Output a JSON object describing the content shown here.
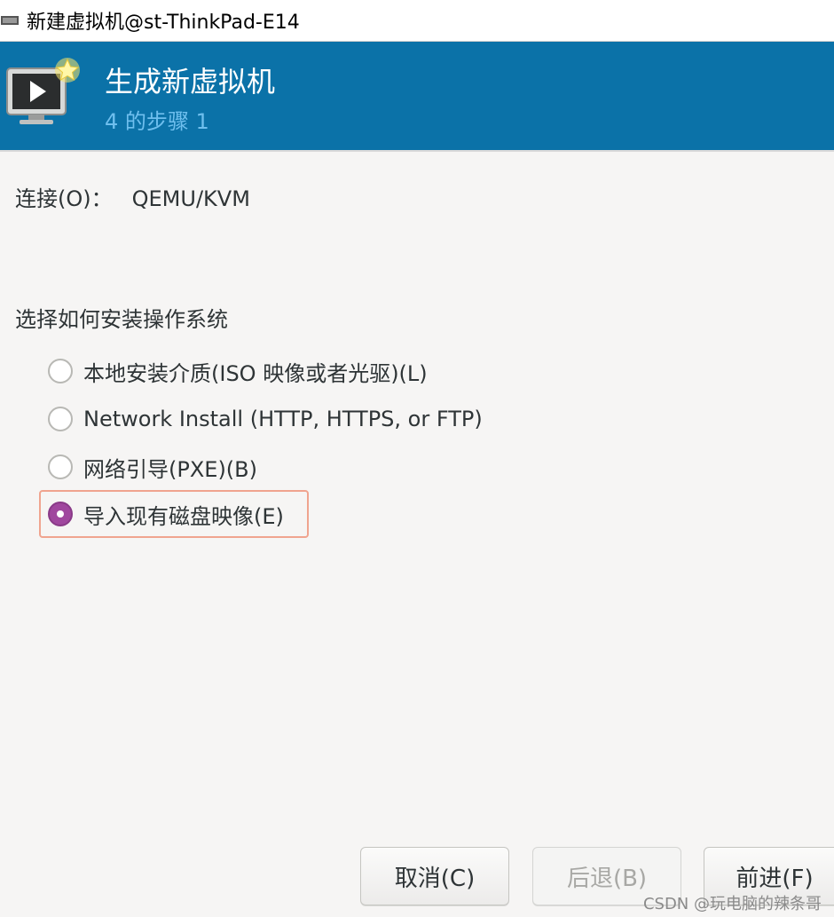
{
  "window": {
    "title": "新建虚拟机@st-ThinkPad-E14"
  },
  "header": {
    "title": "生成新虚拟机",
    "subtitle": "4 的步骤 1",
    "accent_color": "#0b72a8"
  },
  "connection": {
    "label": "连接(O)：",
    "value": "QEMU/KVM"
  },
  "install": {
    "section_label": "选择如何安装操作系统",
    "options": [
      {
        "label": "本地安装介质(ISO 映像或者光驱)(L)",
        "checked": false
      },
      {
        "label": "Network Install (HTTP, HTTPS, or FTP)",
        "checked": false
      },
      {
        "label": "网络引导(PXE)(B)",
        "checked": false
      },
      {
        "label": "导入现有磁盘映像(E)",
        "checked": true
      }
    ],
    "selected_color": "#a0479e"
  },
  "buttons": {
    "cancel": "取消(C)",
    "back": "后退(B)",
    "forward": "前进(F)"
  },
  "watermark": "CSDN @玩电脑的辣条哥"
}
